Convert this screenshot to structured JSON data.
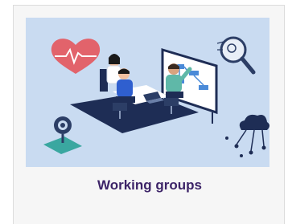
{
  "card": {
    "title": "Working groups",
    "image_icons": [
      "heart-pulse-icon",
      "magnifier-icon",
      "webcam-icon",
      "cloud-network-icon"
    ],
    "colors": {
      "title": "#3d2468",
      "image_background": "#c9dbf1",
      "card_background": "#f6f6f6"
    }
  }
}
